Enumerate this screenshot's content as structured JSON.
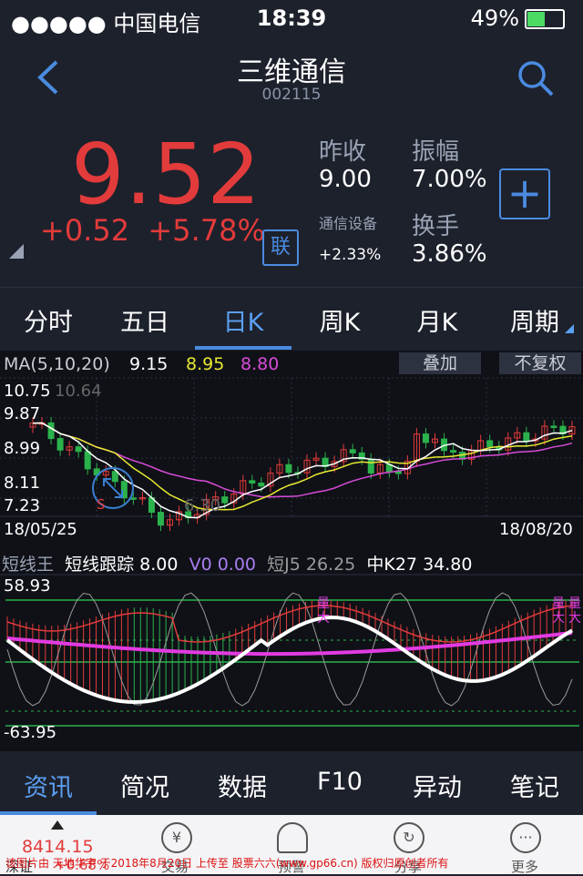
{
  "status": {
    "carrier": "●●●●● 中国电信",
    "time": "18:39",
    "battery": "49%"
  },
  "header": {
    "title": "三维通信",
    "code": "002115"
  },
  "quote": {
    "price": "9.52",
    "change": "+0.52",
    "change_pct": "+5.78%",
    "prev_close_label": "昨收",
    "prev_close": "9.00",
    "amplitude_label": "振幅",
    "amplitude": "7.00%",
    "sector": "通信设备",
    "sector_pct": "+2.33%",
    "turnover_label": "换手",
    "turnover": "3.86%",
    "lian": "联",
    "plus": "+"
  },
  "tabs": [
    "分时",
    "五日",
    "日K",
    "周K",
    "月K",
    "周期"
  ],
  "ma": {
    "label": "MA(5,10,20)",
    "ma5": "9.15",
    "ma10": "8.95",
    "ma20": "8.80",
    "overlay": "叠加",
    "adjust": "不复权"
  },
  "price_axis": {
    "top": "10.75",
    "high_mark": "10.64",
    "p2": "9.87",
    "p3": "8.99",
    "p4": "8.11",
    "bottom": "7.23",
    "low_mark": "6.30"
  },
  "dates": {
    "start": "18/05/25",
    "end": "18/08/20"
  },
  "indicator": {
    "name": "短线王",
    "track_label": "短线跟踪",
    "track": "8.00",
    "v0_label": "V0",
    "v0": "0.00",
    "j5_label": "短J5",
    "j5": "26.25",
    "k27_label": "中K27",
    "k27": "34.80",
    "max": "58.93",
    "min": "-63.95",
    "mark": "量大"
  },
  "subtabs": [
    "资讯",
    "简况",
    "数据",
    "F10",
    "异动",
    "笔记"
  ],
  "bottomnav": {
    "index_label": "深证",
    "index_value": "8414.15",
    "index_pct": "+0.68%",
    "items": [
      "交易",
      "预警",
      "分享",
      "更多"
    ]
  },
  "watermark": "该图片由 天地华宇 于2018年8月20日 上传至 股票六六(www.gp66.cn) 版权归原创者所有",
  "colors": {
    "up": "#e23b3b",
    "down": "#2bb24c",
    "accent": "#4a8be0",
    "ma5": "#ffffff",
    "ma10": "#e8e832",
    "ma20": "#d84bd8"
  }
}
